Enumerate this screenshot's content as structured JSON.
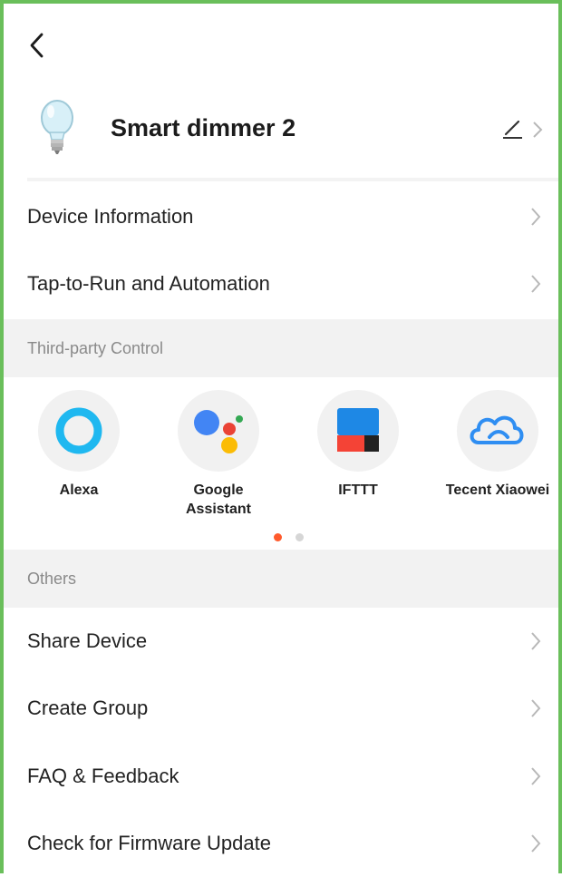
{
  "header": {
    "device_name": "Smart dimmer 2"
  },
  "menu_top": [
    {
      "label": "Device Information"
    },
    {
      "label": "Tap-to-Run and Automation"
    }
  ],
  "third_party": {
    "section_title": "Third-party Control",
    "items": [
      {
        "line1": "Alexa",
        "line2": "",
        "icon": "alexa-icon"
      },
      {
        "line1": "Google",
        "line2": "Assistant",
        "icon": "google-assistant-icon"
      },
      {
        "line1": "IFTTT",
        "line2": "",
        "icon": "ifttt-icon"
      },
      {
        "line1": "Tecent Xiaowei",
        "line2": "",
        "icon": "tecent-xiaowei-icon"
      }
    ],
    "page_indicator": {
      "count": 2,
      "active": 1
    }
  },
  "others": {
    "section_title": "Others",
    "items": [
      {
        "label": "Share Device"
      },
      {
        "label": "Create Group"
      },
      {
        "label": "FAQ & Feedback"
      },
      {
        "label": "Check for Firmware Update"
      }
    ]
  },
  "colors": {
    "frame_border": "#6abf5b",
    "section_bg": "#f2f2f2",
    "active_dot": "#ff5a2c",
    "inactive_dot": "#d6d6d6",
    "alexa": "#1fb8f0",
    "cloud": "#2f8ef2"
  }
}
